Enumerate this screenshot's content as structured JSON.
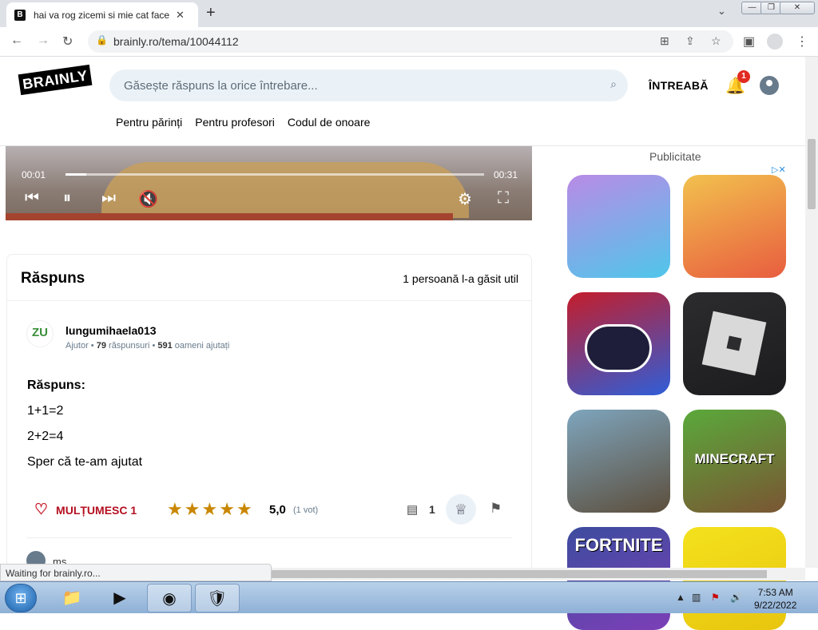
{
  "browser": {
    "tab_title": "hai va rog zicemi si mie cat face",
    "tab_favicon": "B",
    "url": "brainly.ro/tema/10044112",
    "status_text": "Waiting for brainly.ro..."
  },
  "site": {
    "logo_text": "BRAINLY",
    "search_placeholder": "Găsește răspuns la orice întrebare...",
    "ask_label": "ÎNTREABĂ",
    "notification_count": "1",
    "nav": [
      "Pentru părinți",
      "Pentru profesori",
      "Codul de onoare"
    ]
  },
  "video": {
    "time_current": "00:01",
    "time_total": "00:31",
    "progress": 0.05
  },
  "answer": {
    "title": "Răspuns",
    "helpful": "1 persoană l-a găsit util",
    "author": {
      "avatar_text": "ZU",
      "name": "lungumihaela013",
      "rank": "Ajutor",
      "answers_count": "79",
      "answers_label": "răspunsuri",
      "helped_count": "591",
      "helped_label": "oameni ajutați"
    },
    "body_label": "Răspuns:",
    "lines": [
      "1+1=2",
      "2+2=4",
      "Sper că te-am ajutat"
    ],
    "thanks_label": "MULȚUMESC",
    "thanks_count": "1",
    "stars": 5,
    "rating": "5,0",
    "votes": "(1 vot)",
    "comments_count": "1",
    "commenter": "ms"
  },
  "ads": {
    "label": "Publicitate",
    "apps": [
      {
        "name": "",
        "colors": [
          "#b98be6",
          "#4fc6ea"
        ]
      },
      {
        "name": "",
        "colors": [
          "#f2c14e",
          "#e85d3f"
        ]
      },
      {
        "name": "",
        "colors": [
          "#c41d2b",
          "#2f5ed8"
        ]
      },
      {
        "name": "",
        "colors": [
          "#2c2c2e",
          "#1c1c1e"
        ]
      },
      {
        "name": "",
        "colors": [
          "#7ea5bd",
          "#5c4e3c"
        ]
      },
      {
        "name": "MINECRAFT",
        "colors": [
          "#5aa93b",
          "#7a5533"
        ]
      },
      {
        "name": "FORTNITE",
        "colors": [
          "#3c4c9e",
          "#7c3fb7"
        ]
      },
      {
        "name": "",
        "colors": [
          "#f4e21d",
          "#e8c50e"
        ]
      }
    ]
  },
  "taskbar": {
    "time": "7:53 AM",
    "date": "9/22/2022"
  }
}
